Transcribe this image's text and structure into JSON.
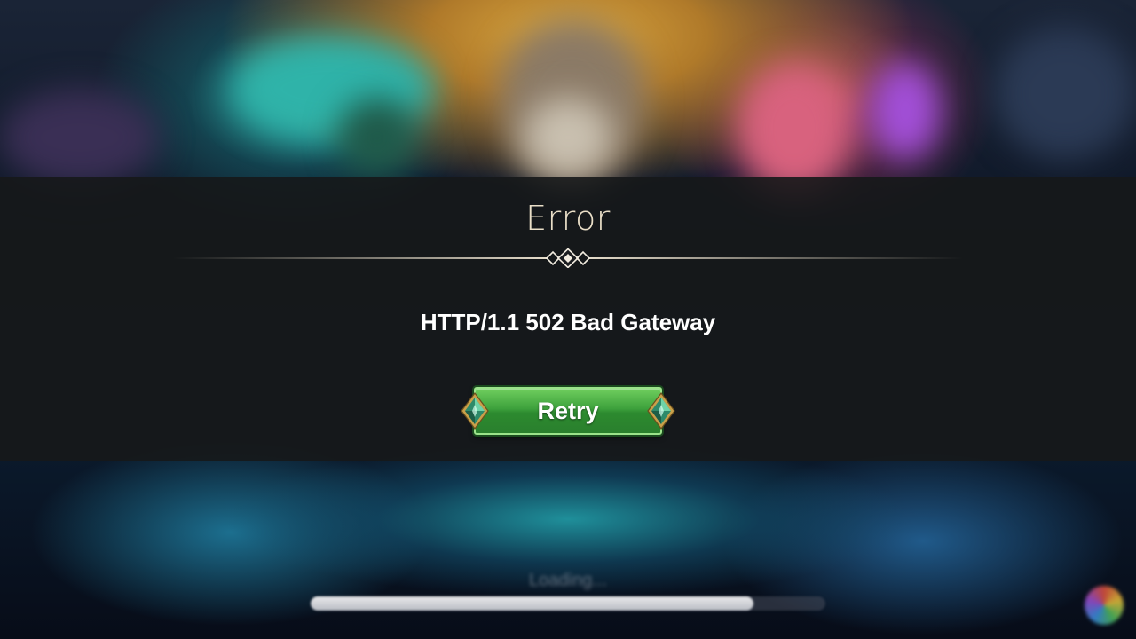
{
  "modal": {
    "title": "Error",
    "message": "HTTP/1.1 502 Bad Gateway",
    "retry_label": "Retry"
  },
  "background": {
    "loading_text": "Loading...",
    "loading_progress": 0.86
  },
  "icons": {
    "divider_ornament": "triple-diamond-icon",
    "button_ornaments": "emerald-gem-icon",
    "corner": "color-wheel-icon"
  },
  "colors": {
    "title": "#eadfc8",
    "retry_button": "#3da13c",
    "modal_band": "#16181a"
  }
}
